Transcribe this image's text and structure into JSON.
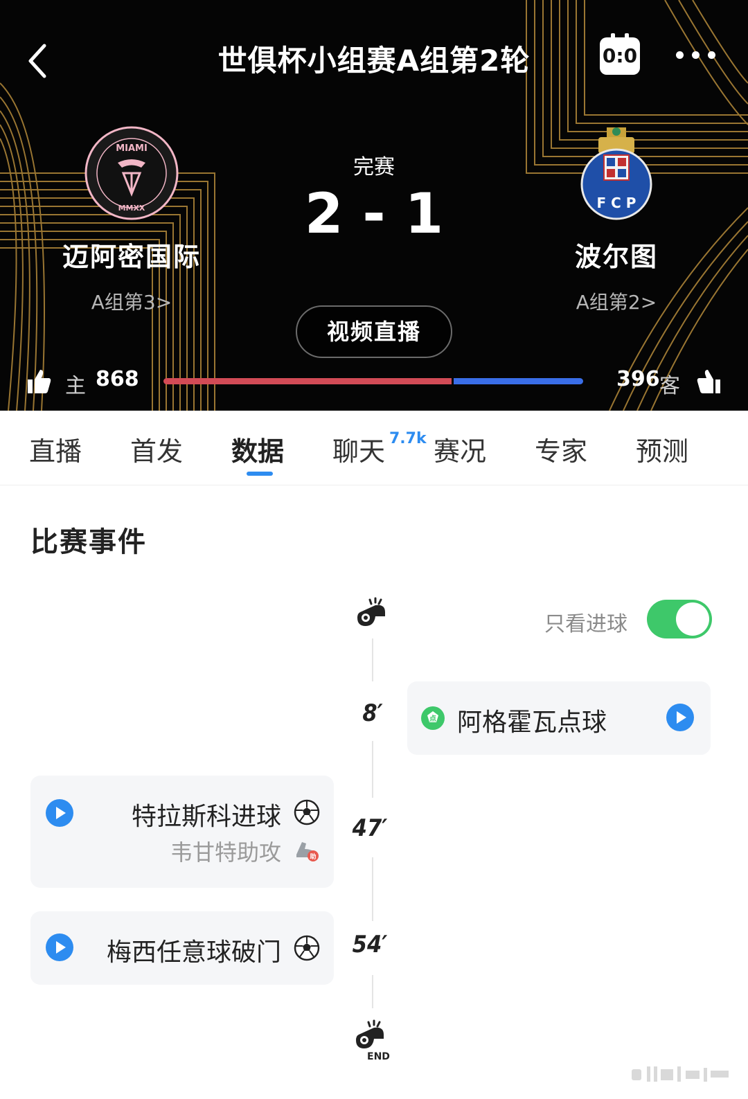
{
  "header": {
    "title": "世俱杯小组赛A组第2轮",
    "score_icon_text": "0:0",
    "status": "完赛",
    "score": "2 - 1",
    "video_button": "视频直播"
  },
  "home_team": {
    "name": "迈阿密国际",
    "rank": "A组第3",
    "crest_text_top": "MIAMI",
    "crest_text_bottom": "MMXX"
  },
  "away_team": {
    "name": "波尔图",
    "rank": "A组第2",
    "crest_text": "F C P"
  },
  "votes": {
    "home_label": "主",
    "home_count": "868",
    "away_label": "客",
    "away_count": "396",
    "home_share": 0.687,
    "home_color": "#d24b56",
    "away_color": "#3a6ee8"
  },
  "tabs": [
    {
      "label": "直播"
    },
    {
      "label": "首发"
    },
    {
      "label": "数据"
    },
    {
      "label": "聊天",
      "badge": "7.7k"
    },
    {
      "label": "赛况"
    },
    {
      "label": "专家"
    },
    {
      "label": "预测"
    }
  ],
  "active_tab": "数据",
  "events_section": {
    "title": "比赛事件",
    "filter_label": "只看进球",
    "filter_on": true,
    "events": [
      {
        "minute": "8′",
        "side": "away",
        "text": "阿格霍瓦点球",
        "icon": "penalty-icon"
      },
      {
        "minute": "47′",
        "side": "home",
        "text": "特拉斯科进球",
        "assist": "韦甘特助攻",
        "icon": "soccer-ball-icon"
      },
      {
        "minute": "54′",
        "side": "home",
        "text": "梅西任意球破门",
        "icon": "soccer-ball-icon"
      }
    ],
    "end_label": "END"
  },
  "colors": {
    "accent": "#2d8cf0",
    "toggle_on": "#3ec86a",
    "gold": "#c9a24a"
  }
}
